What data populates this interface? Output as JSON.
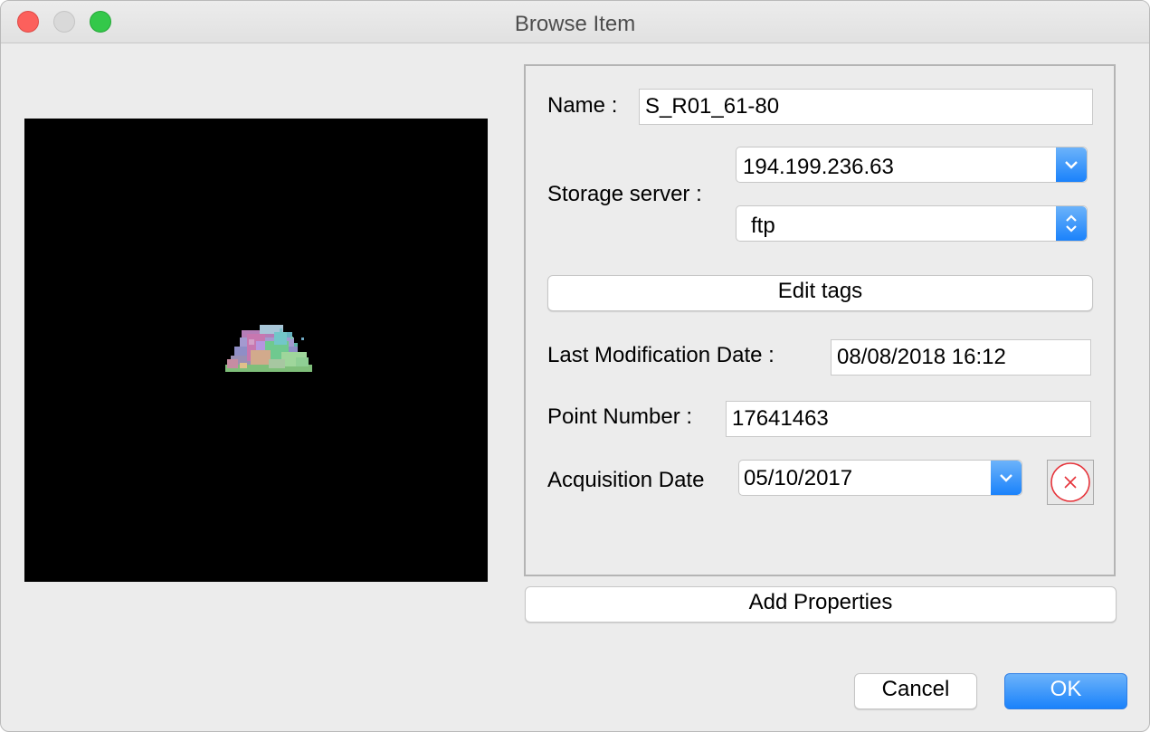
{
  "window": {
    "title": "Browse Item"
  },
  "form": {
    "name_label": "Name :",
    "name_value": "S_R01_61-80",
    "storage_label": "Storage server :",
    "server_value": "194.199.236.63",
    "protocol_value": "ftp",
    "edit_tags_label": "Edit tags",
    "last_mod_label": "Last Modification Date :",
    "last_mod_value": "08/08/2018 16:12",
    "point_number_label": "Point Number :",
    "point_number_value": "17641463",
    "acq_date_label": "Acquisition Date",
    "acq_date_value": "05/10/2017"
  },
  "actions": {
    "add_properties_label": "Add Properties",
    "cancel_label": "Cancel",
    "ok_label": "OK"
  },
  "colors": {
    "accent": "#1a82fb",
    "clear_icon": "#e6333a"
  }
}
